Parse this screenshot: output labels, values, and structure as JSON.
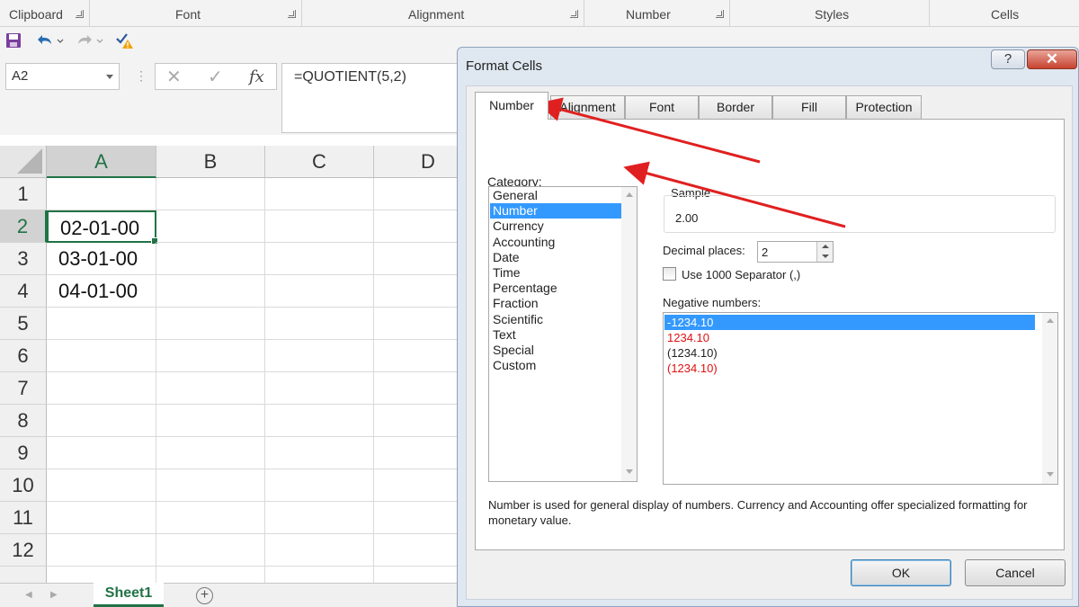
{
  "ribbon": {
    "groups": [
      "Clipboard",
      "Font",
      "Alignment",
      "Number",
      "Styles",
      "Cells"
    ]
  },
  "formula_bar": {
    "name_box": "A2",
    "cancel_symbol": "✕",
    "enter_symbol": "✓",
    "fx_label": "fx",
    "formula": "=QUOTIENT(5,2)"
  },
  "sheet": {
    "columns": [
      "A",
      "B",
      "C",
      "D"
    ],
    "rows": [
      "1",
      "2",
      "3",
      "4",
      "5",
      "6",
      "7",
      "8",
      "9",
      "10",
      "11",
      "12"
    ],
    "cells": {
      "A2": "02-01-00",
      "A3": "03-01-00",
      "A4": "04-01-00"
    },
    "tab_name": "Sheet1",
    "add_sheet_symbol": "+"
  },
  "dialog": {
    "title": "Format Cells",
    "help_label": "?",
    "close_label": "✕",
    "tabs": [
      "Number",
      "Alignment",
      "Font",
      "Border",
      "Fill",
      "Protection"
    ],
    "category_label": "Category:",
    "categories": [
      "General",
      "Number",
      "Currency",
      "Accounting",
      "Date",
      "Time",
      "Percentage",
      "Fraction",
      "Scientific",
      "Text",
      "Special",
      "Custom"
    ],
    "selected_category": "Number",
    "sample_label": "Sample",
    "sample_value": "2.00",
    "decimal_places_label": "Decimal places:",
    "decimal_places_value": "2",
    "separator_label": "Use 1000 Separator (,)",
    "negative_label": "Negative numbers:",
    "negative_options": [
      "-1234.10",
      "1234.10",
      "(1234.10)",
      "(1234.10)"
    ],
    "description": "Number is used for general display of numbers.  Currency and Accounting offer specialized formatting for monetary value.",
    "ok_label": "OK",
    "cancel_label": "Cancel"
  },
  "colors": {
    "excel_green": "#217346",
    "selection_blue": "#3399ff",
    "negative_red": "#e01010",
    "annotation_arrow": "#e02020"
  }
}
